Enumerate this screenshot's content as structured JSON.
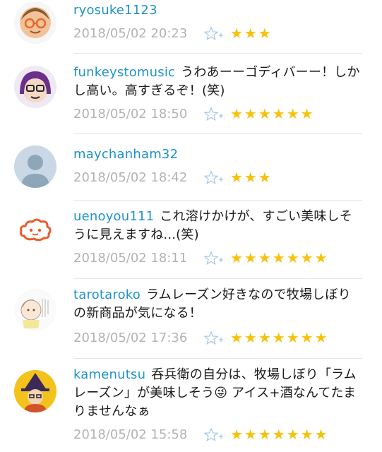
{
  "comments": [
    {
      "username": "ryosuke1123",
      "text": "",
      "timestamp": "2018/05/02 20:23",
      "stars": "★★★",
      "avatar": "bald-man-glasses"
    },
    {
      "username": "funkeystomusic",
      "text": "うわあーーゴディバーー！しかし高い。高すぎるぞ！(笑)",
      "timestamp": "2018/05/02 18:50",
      "stars": "★★★★★★",
      "avatar": "purple-hair-glasses"
    },
    {
      "username": "maychanham32",
      "text": "",
      "timestamp": "2018/05/02 18:42",
      "stars": "★★★",
      "avatar": "default-silhouette"
    },
    {
      "username": "uenoyou111",
      "text": "これ溶けかけが、すごい美味しそうに見えますね...(笑)",
      "timestamp": "2018/05/02 18:11",
      "stars": "★★★★★★★",
      "avatar": "orange-cloud-face"
    },
    {
      "username": "tarotaroko",
      "text": "ラムレーズン好きなので牧場しぼりの新商品が気になる！",
      "timestamp": "2018/05/02 17:36",
      "stars": "★★★★★★★",
      "avatar": "baby-sketch"
    },
    {
      "username": "kamenutsu",
      "text": "呑兵衛の自分は、牧場しぼり「ラムレーズン」が美味しそう😜 アイス+酒なんてたまりませんなぁ",
      "timestamp": "2018/05/02 15:58",
      "stars": "★★★★★★★",
      "avatar": "witch-hat-character"
    }
  ],
  "colors": {
    "username": "#1f93c8",
    "star": "#f5c20a",
    "meta": "#b3b3b3",
    "fav_icon": "#a9c8e6"
  },
  "icons": {
    "favorite": "star-plus-icon"
  }
}
